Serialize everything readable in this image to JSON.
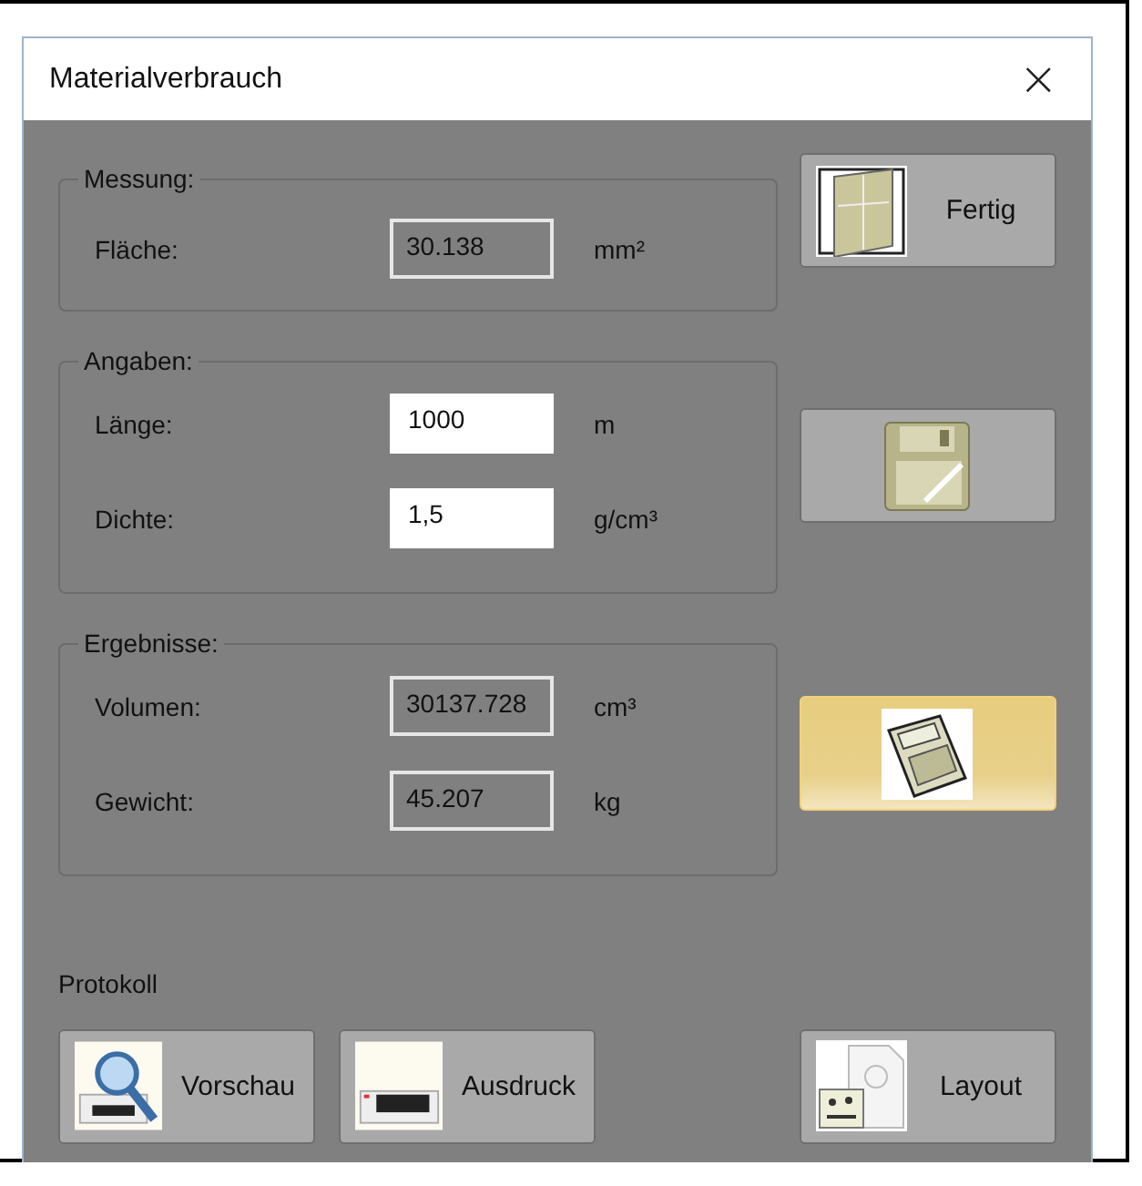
{
  "window": {
    "title": "Materialverbrauch",
    "close": "×"
  },
  "groups": [
    {
      "legend": "Messung:",
      "rows": [
        {
          "label": "Fläche:",
          "value": "30.138",
          "unit": "mm²",
          "kind": "readonly"
        }
      ]
    },
    {
      "legend": "Angaben:",
      "rows": [
        {
          "label": "Länge:",
          "value": "1000",
          "unit": "m",
          "kind": "input"
        },
        {
          "label": "Dichte:",
          "value": "1,5",
          "unit": "g/cm³",
          "kind": "input"
        }
      ]
    },
    {
      "legend": "Ergebnisse:",
      "rows": [
        {
          "label": "Volumen:",
          "value": "30137.728",
          "unit": "cm³",
          "kind": "readonly"
        },
        {
          "label": "Gewicht:",
          "value": "45.207",
          "unit": "kg",
          "kind": "readonly"
        }
      ]
    }
  ],
  "side_buttons": [
    {
      "label": "Fertig",
      "highlighted": false
    },
    {
      "highlighted": false
    },
    {
      "highlighted": true
    }
  ],
  "protokoll": {
    "label": "Protokoll",
    "buttons": [
      {
        "label": "Vorschau"
      },
      {
        "label": "Ausdruck"
      },
      {
        "label": "Layout"
      }
    ]
  }
}
